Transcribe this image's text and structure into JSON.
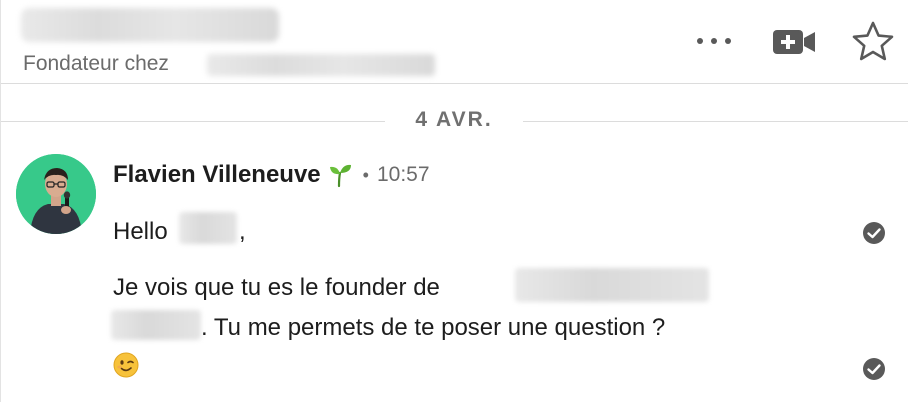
{
  "header": {
    "subtitle": "Fondateur chez",
    "actions": {
      "more": "more-icon",
      "video": "video-add-icon",
      "star": "star-icon"
    }
  },
  "conversation": {
    "date_divider": "4 AVR.",
    "messages": [
      {
        "sender": "Flavien Villeneuve",
        "badge": "sprout-icon",
        "separator": "•",
        "time": "10:57",
        "line1_greeting": "Hello",
        "line1_comma": ",",
        "line2_text": "Je vois que tu es le founder de",
        "line3_text": ". Tu me permets de te poser une question ?",
        "emoji": "winking-face-icon",
        "status_icon": "read-check-icon"
      }
    ]
  },
  "colors": {
    "avatar_bg": "#37c98a",
    "text": "#1d1d1d",
    "muted": "#6b6b6b",
    "icon": "#595959"
  }
}
